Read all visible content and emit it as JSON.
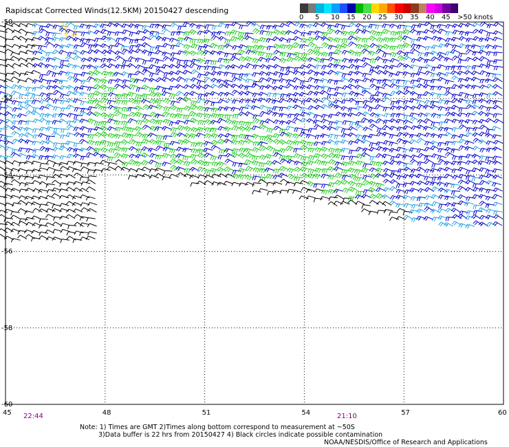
{
  "title": "Rapidscat Corrected Winds(12.5KM) 20150427 descending",
  "scale": {
    "colors": [
      "#3a3a3a",
      "#7a7a7a",
      "#00b4e0",
      "#00e6ff",
      "#0aa0ff",
      "#1e50ff",
      "#0000aa",
      "#00b400",
      "#44e044",
      "#ffd800",
      "#ffaa00",
      "#ff5000",
      "#ff0000",
      "#c80000",
      "#8c3c1e",
      "#c08060",
      "#ff00ff",
      "#d000e0",
      "#7000a0",
      "#400070"
    ],
    "labels": [
      "0",
      "5",
      "10",
      "15",
      "20",
      "25",
      "30",
      "35",
      "40",
      "45",
      ">50 knots"
    ]
  },
  "map": {
    "lon_range": [
      45,
      60
    ],
    "lat_range": [
      -50,
      -60
    ],
    "x_ticks": [
      "45",
      "48",
      "51",
      "54",
      "57",
      "60"
    ],
    "y_ticks": [
      "-50",
      "-52",
      "-54",
      "-56",
      "-58",
      "-60"
    ],
    "times": {
      "left": "22:44",
      "right": "21:10"
    },
    "barb_colors": {
      "calm": "#000000",
      "light": "#20a0e0",
      "moderate": "#0000cc",
      "fresh": "#22cc22"
    }
  },
  "notes": {
    "line1": "Note: 1) Times are GMT 2)Times along bottom correspond to measurement at ~50S",
    "line2": "3)Data buffer is 22 hrs from 20150427 4) Black circles indicate possible contamination",
    "line3": "NOAA/NESDIS/Office of Research and Applications"
  }
}
